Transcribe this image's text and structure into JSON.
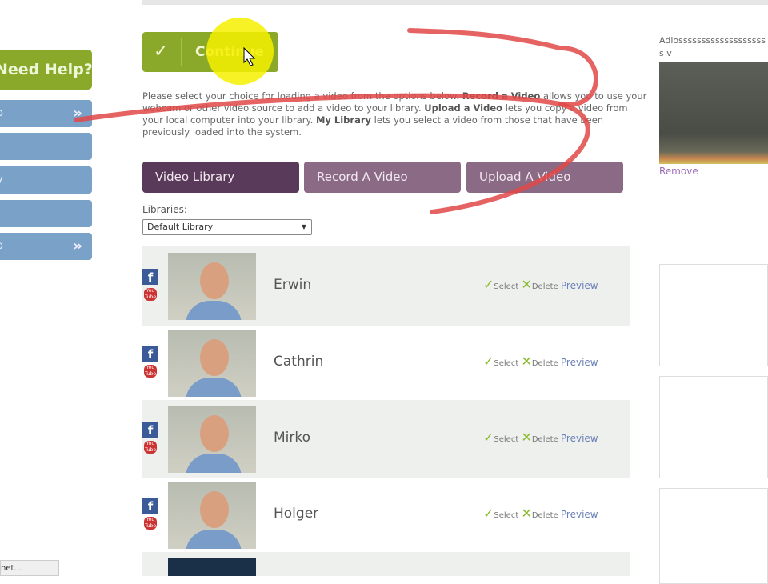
{
  "sidebar": {
    "help_label": "Need Help?",
    "items": [
      {
        "label": "o",
        "chevron": "»"
      },
      {
        "label": ""
      },
      {
        "label": "y"
      },
      {
        "label": ""
      },
      {
        "label": "o",
        "chevron": "»"
      }
    ]
  },
  "continue_label": "Continue",
  "instructions": {
    "p1": "Please select your choice for loading a video from the options below. ",
    "b1": "Record a Video",
    "p2": " allows you to use your webcam or other video source to add a video to your library. ",
    "b2": "Upload a Video",
    "p3": " lets you copy a video from your local computer into your library. ",
    "b3": "My Library",
    "p4": " lets you select a video from those that have been previously loaded into the system."
  },
  "tabs": [
    {
      "label": "Video Library"
    },
    {
      "label": "Record A Video"
    },
    {
      "label": "Upload A Video"
    }
  ],
  "libraries": {
    "label": "Libraries:",
    "selected": "Default Library"
  },
  "videos": [
    {
      "name": "Erwin"
    },
    {
      "name": "Cathrin"
    },
    {
      "name": "Mirko"
    },
    {
      "name": "Holger"
    }
  ],
  "actions": {
    "select": "Select",
    "delete": "Delete",
    "preview": "Preview"
  },
  "social": {
    "facebook": "f",
    "youtube": "You Tube"
  },
  "right_panel": {
    "title": "Adiossssssssssssssssssss v",
    "remove": "Remove"
  },
  "bottom_button": "net...",
  "colors": {
    "green": "#8aa82a",
    "blue": "#7aa2c8",
    "purple_dark": "#5a3a5a",
    "purple": "#8a6a85"
  }
}
